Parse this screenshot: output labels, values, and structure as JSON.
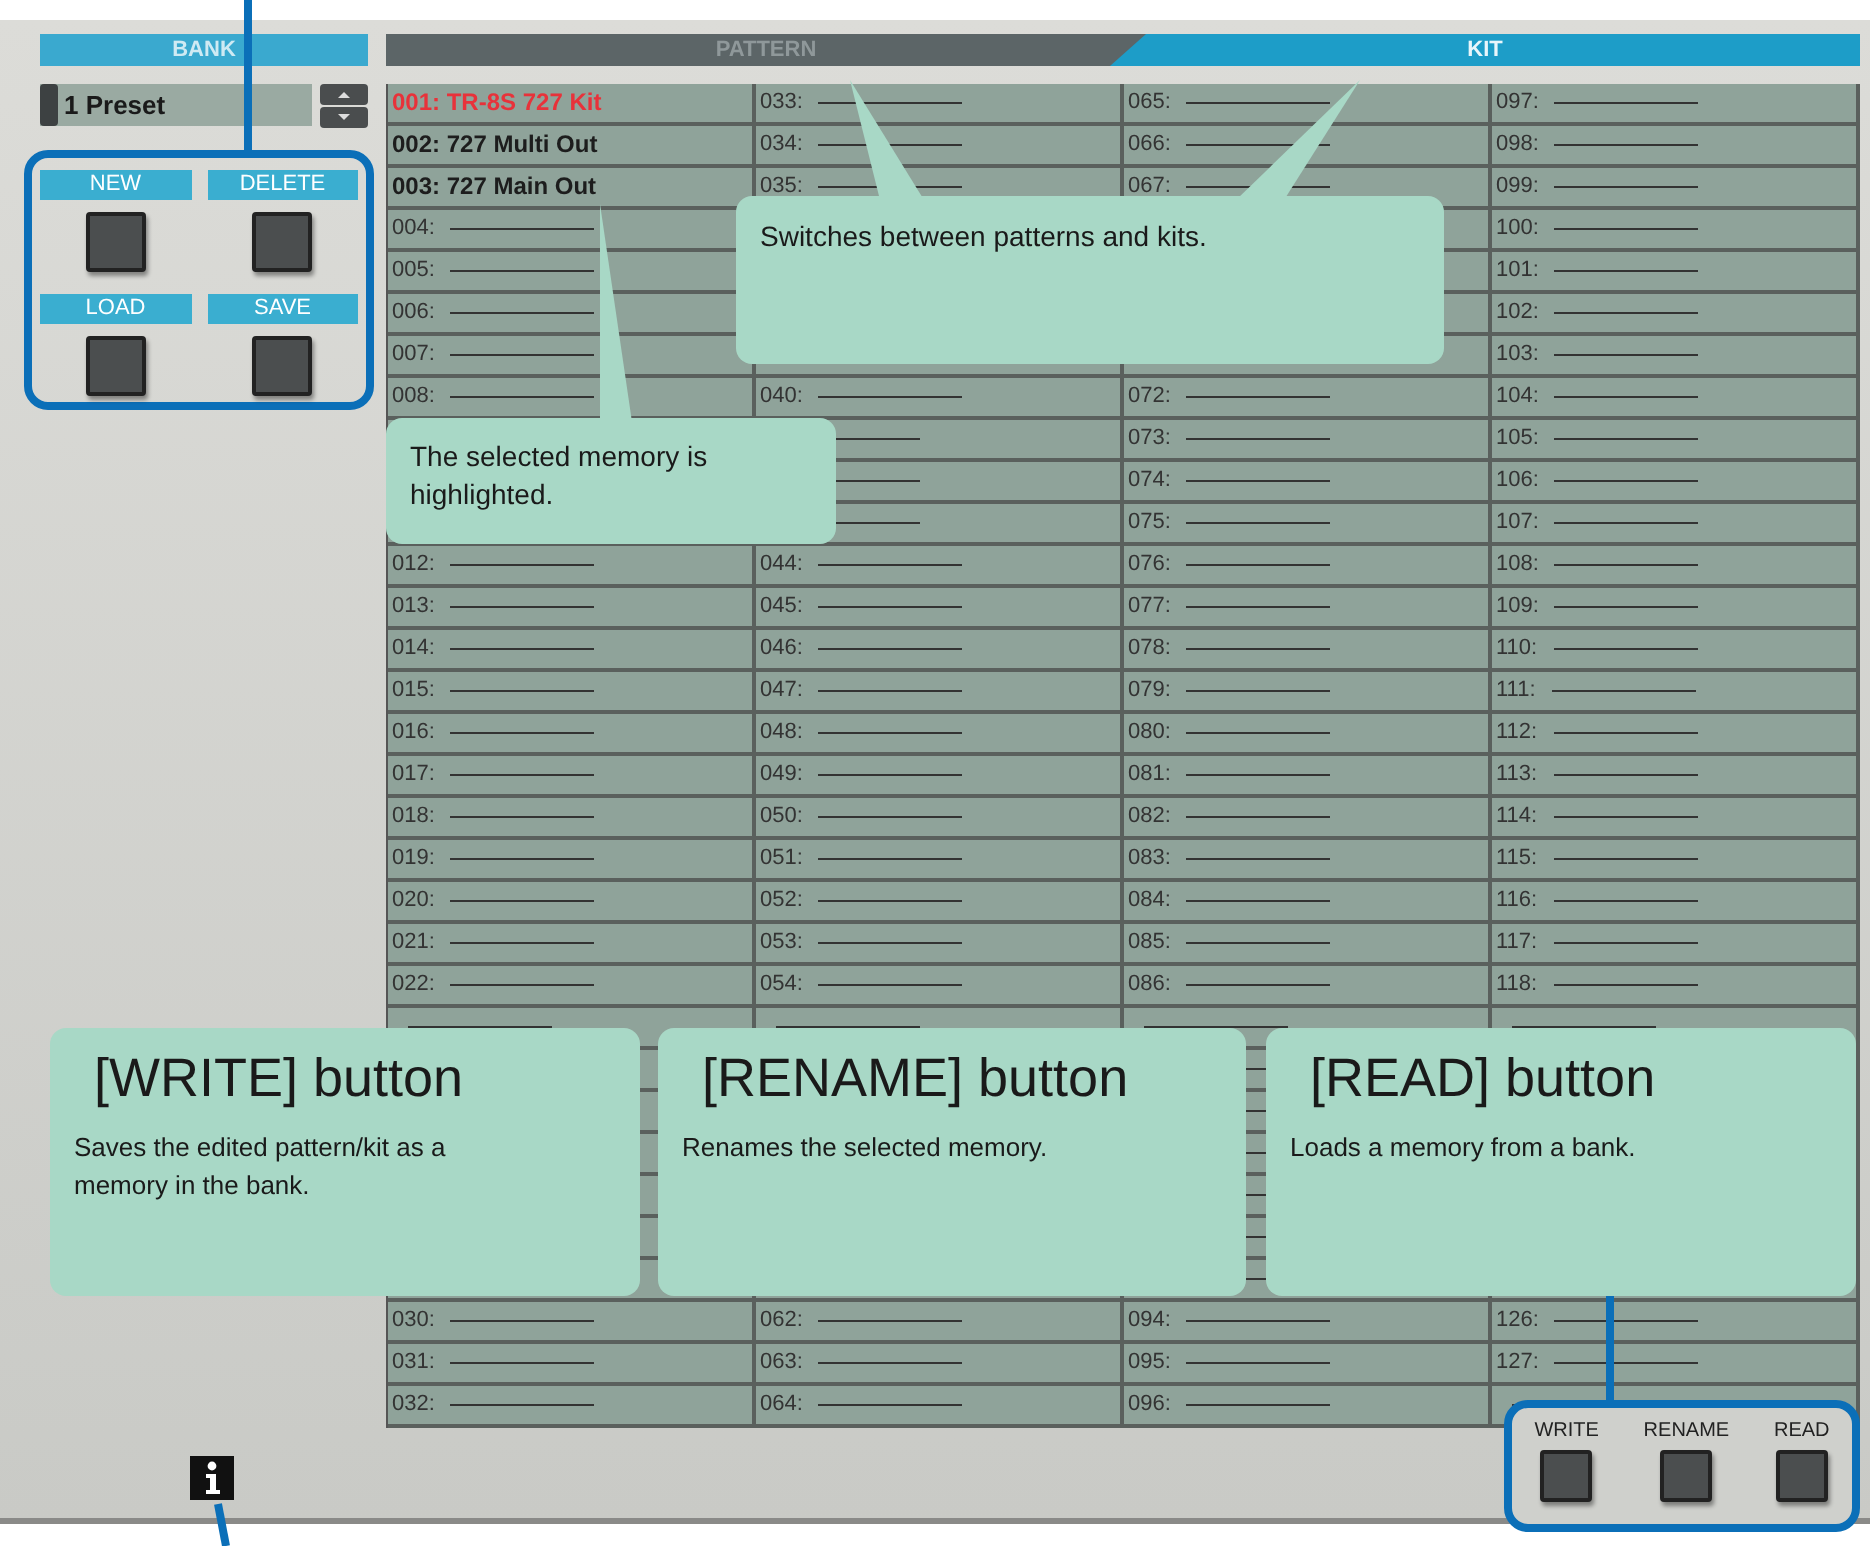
{
  "bank": {
    "header": "BANK",
    "selector": {
      "value": "1 Preset"
    },
    "buttons": [
      {
        "label": "NEW"
      },
      {
        "label": "DELETE"
      },
      {
        "label": "LOAD"
      },
      {
        "label": "SAVE"
      }
    ]
  },
  "tabs": [
    {
      "label": "PATTERN",
      "selected": false
    },
    {
      "label": "KIT",
      "selected": true
    }
  ],
  "memory_columns": [
    {
      "cells": [
        {
          "label": "001: TR-8S 727 Kit",
          "empty": false,
          "selected": true
        },
        {
          "label": "002: 727 Multi Out",
          "empty": false,
          "selected": false
        },
        {
          "label": "003: 727 Main Out",
          "empty": false,
          "selected": false
        },
        {
          "label": "004:",
          "empty": true,
          "selected": false
        },
        {
          "label": "005:",
          "empty": true,
          "selected": false
        },
        {
          "label": "006:",
          "empty": true,
          "selected": false
        },
        {
          "label": "007:",
          "empty": true,
          "selected": false
        },
        {
          "label": "008:",
          "empty": true,
          "selected": false
        },
        null,
        null,
        null,
        {
          "label": "012:",
          "empty": true,
          "selected": false
        },
        {
          "label": "013:",
          "empty": true,
          "selected": false
        },
        {
          "label": "014:",
          "empty": true,
          "selected": false
        },
        {
          "label": "015:",
          "empty": true,
          "selected": false
        },
        {
          "label": "016:",
          "empty": true,
          "selected": false
        },
        {
          "label": "017:",
          "empty": true,
          "selected": false
        },
        {
          "label": "018:",
          "empty": true,
          "selected": false
        },
        {
          "label": "019:",
          "empty": true,
          "selected": false
        },
        {
          "label": "020:",
          "empty": true,
          "selected": false
        },
        {
          "label": "021:",
          "empty": true,
          "selected": false
        },
        {
          "label": "022:",
          "empty": true,
          "selected": false
        },
        null,
        null,
        null,
        null,
        null,
        null,
        null,
        {
          "label": "030:",
          "empty": true,
          "selected": false
        },
        {
          "label": "031:",
          "empty": true,
          "selected": false
        },
        {
          "label": "032:",
          "empty": true,
          "selected": false
        }
      ]
    },
    {
      "cells": [
        {
          "label": "033:",
          "empty": true,
          "selected": false
        },
        {
          "label": "034:",
          "empty": true,
          "selected": false
        },
        {
          "label": "035:",
          "empty": true,
          "selected": false
        },
        null,
        null,
        null,
        null,
        {
          "label": "040:",
          "empty": true,
          "selected": false
        },
        null,
        null,
        null,
        {
          "label": "044:",
          "empty": true,
          "selected": false
        },
        {
          "label": "045:",
          "empty": true,
          "selected": false
        },
        {
          "label": "046:",
          "empty": true,
          "selected": false
        },
        {
          "label": "047:",
          "empty": true,
          "selected": false
        },
        {
          "label": "048:",
          "empty": true,
          "selected": false
        },
        {
          "label": "049:",
          "empty": true,
          "selected": false
        },
        {
          "label": "050:",
          "empty": true,
          "selected": false
        },
        {
          "label": "051:",
          "empty": true,
          "selected": false
        },
        {
          "label": "052:",
          "empty": true,
          "selected": false
        },
        {
          "label": "053:",
          "empty": true,
          "selected": false
        },
        {
          "label": "054:",
          "empty": true,
          "selected": false
        },
        null,
        null,
        null,
        null,
        null,
        null,
        null,
        {
          "label": "062:",
          "empty": true,
          "selected": false
        },
        {
          "label": "063:",
          "empty": true,
          "selected": false
        },
        {
          "label": "064:",
          "empty": true,
          "selected": false
        }
      ]
    },
    {
      "cells": [
        {
          "label": "065:",
          "empty": true,
          "selected": false
        },
        {
          "label": "066:",
          "empty": true,
          "selected": false
        },
        {
          "label": "067:",
          "empty": true,
          "selected": false
        },
        null,
        null,
        null,
        null,
        {
          "label": "072:",
          "empty": true,
          "selected": false
        },
        {
          "label": "073:",
          "empty": true,
          "selected": false
        },
        {
          "label": "074:",
          "empty": true,
          "selected": false
        },
        {
          "label": "075:",
          "empty": true,
          "selected": false
        },
        {
          "label": "076:",
          "empty": true,
          "selected": false
        },
        {
          "label": "077:",
          "empty": true,
          "selected": false
        },
        {
          "label": "078:",
          "empty": true,
          "selected": false
        },
        {
          "label": "079:",
          "empty": true,
          "selected": false
        },
        {
          "label": "080:",
          "empty": true,
          "selected": false
        },
        {
          "label": "081:",
          "empty": true,
          "selected": false
        },
        {
          "label": "082:",
          "empty": true,
          "selected": false
        },
        {
          "label": "083:",
          "empty": true,
          "selected": false
        },
        {
          "label": "084:",
          "empty": true,
          "selected": false
        },
        {
          "label": "085:",
          "empty": true,
          "selected": false
        },
        {
          "label": "086:",
          "empty": true,
          "selected": false
        },
        null,
        null,
        null,
        null,
        null,
        null,
        null,
        {
          "label": "094:",
          "empty": true,
          "selected": false
        },
        {
          "label": "095:",
          "empty": true,
          "selected": false
        },
        {
          "label": "096:",
          "empty": true,
          "selected": false
        }
      ]
    },
    {
      "cells": [
        {
          "label": "097:",
          "empty": true,
          "selected": false
        },
        {
          "label": "098:",
          "empty": true,
          "selected": false
        },
        {
          "label": "099:",
          "empty": true,
          "selected": false
        },
        {
          "label": "100:",
          "empty": true,
          "selected": false
        },
        {
          "label": "101:",
          "empty": true,
          "selected": false
        },
        {
          "label": "102:",
          "empty": true,
          "selected": false
        },
        {
          "label": "103:",
          "empty": true,
          "selected": false
        },
        {
          "label": "104:",
          "empty": true,
          "selected": false
        },
        {
          "label": "105:",
          "empty": true,
          "selected": false
        },
        {
          "label": "106:",
          "empty": true,
          "selected": false
        },
        {
          "label": "107:",
          "empty": true,
          "selected": false
        },
        {
          "label": "108:",
          "empty": true,
          "selected": false
        },
        {
          "label": "109:",
          "empty": true,
          "selected": false
        },
        {
          "label": "110:",
          "empty": true,
          "selected": false
        },
        {
          "label": "111:",
          "empty": true,
          "selected": false
        },
        {
          "label": "112:",
          "empty": true,
          "selected": false
        },
        {
          "label": "113:",
          "empty": true,
          "selected": false
        },
        {
          "label": "114:",
          "empty": true,
          "selected": false
        },
        {
          "label": "115:",
          "empty": true,
          "selected": false
        },
        {
          "label": "116:",
          "empty": true,
          "selected": false
        },
        {
          "label": "117:",
          "empty": true,
          "selected": false
        },
        {
          "label": "118:",
          "empty": true,
          "selected": false
        },
        null,
        null,
        null,
        null,
        null,
        null,
        null,
        {
          "label": "126:",
          "empty": true,
          "selected": false
        },
        {
          "label": "127:",
          "empty": true,
          "selected": false
        },
        null
      ]
    }
  ],
  "footer_buttons": [
    {
      "label": "WRITE"
    },
    {
      "label": "RENAME"
    },
    {
      "label": "READ"
    }
  ],
  "callouts": [
    {
      "kind": "note",
      "text": "Switches between patterns and kits."
    },
    {
      "kind": "note",
      "text": "The selected memory is highlighted."
    },
    {
      "kind": "titled",
      "title": "[WRITE] button",
      "text": "Saves the edited pattern/kit as a memory in the bank."
    },
    {
      "kind": "titled",
      "title": "[RENAME] button",
      "text": "Renames the selected memory."
    },
    {
      "kind": "titled",
      "title": "[READ] button",
      "text": "Loads a memory from a bank."
    }
  ]
}
